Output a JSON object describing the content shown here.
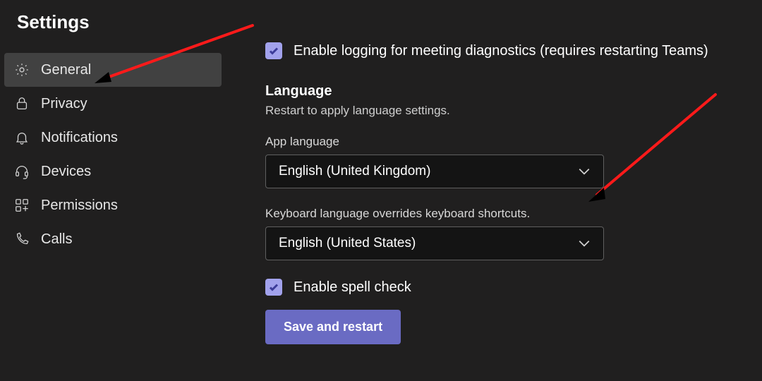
{
  "title": "Settings",
  "sidebar": {
    "items": [
      {
        "label": "General"
      },
      {
        "label": "Privacy"
      },
      {
        "label": "Notifications"
      },
      {
        "label": "Devices"
      },
      {
        "label": "Permissions"
      },
      {
        "label": "Calls"
      }
    ]
  },
  "diagnostics": {
    "label": "Enable logging for meeting diagnostics (requires restarting Teams)"
  },
  "language": {
    "heading": "Language",
    "subtext": "Restart to apply language settings.",
    "app_label": "App language",
    "app_value": "English (United Kingdom)",
    "keyboard_label": "Keyboard language overrides keyboard shortcuts.",
    "keyboard_value": "English (United States)",
    "spellcheck_label": "Enable spell check",
    "button": "Save and restart"
  }
}
